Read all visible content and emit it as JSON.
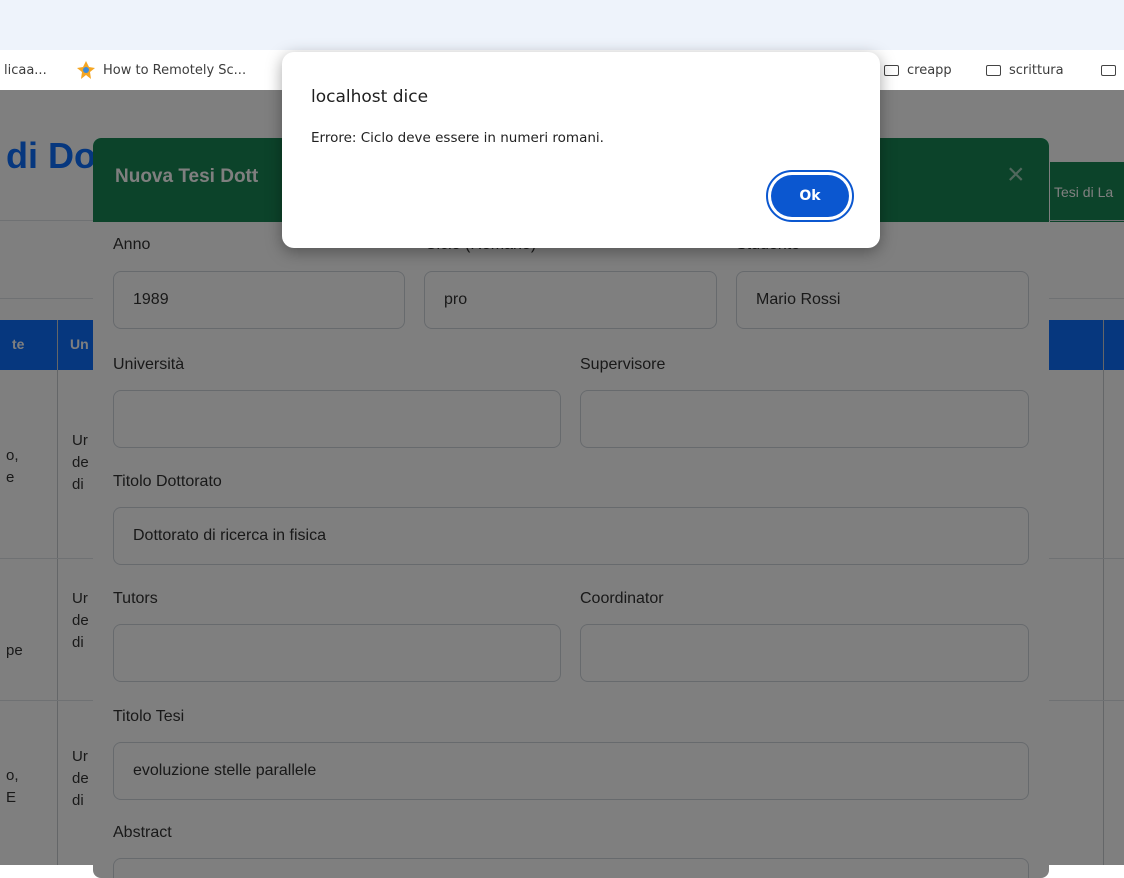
{
  "bookmarks": {
    "left_truncated": "licaa...",
    "how_to": "How to Remotely Sc...",
    "folder1": "creapp",
    "folder2": "scrittura"
  },
  "page": {
    "title_fragment": "di Do",
    "tab_fragment": "Tesi di La",
    "header_cols": [
      "te",
      "Un"
    ],
    "rows": [
      {
        "c1": [
          "o,",
          "e"
        ],
        "c2": [
          "Ur",
          "de",
          "di"
        ]
      },
      {
        "c1": [
          "pe"
        ],
        "c2": [
          "Ur",
          "de",
          "di"
        ]
      },
      {
        "c1": [
          "o,",
          "E"
        ],
        "c2": [
          "Ur",
          "de",
          "di"
        ]
      }
    ]
  },
  "modal": {
    "title": "Nuova Tesi Dott",
    "close": "×",
    "labels": {
      "anno": "Anno",
      "ciclo": "Ciclo (Romano)",
      "studente": "Studente",
      "universita": "Università",
      "supervisore": "Supervisore",
      "titolo_dottorato": "Titolo Dottorato",
      "tutors": "Tutors",
      "coordinator": "Coordinator",
      "titolo_tesi": "Titolo Tesi",
      "abstract": "Abstract"
    },
    "values": {
      "anno": "1989",
      "ciclo": "pro",
      "studente": "Mario Rossi",
      "universita": "",
      "supervisore": "",
      "titolo_dottorato": "Dottorato di ricerca in fisica",
      "tutors": "",
      "coordinator": "",
      "titolo_tesi": "evoluzione stelle parallele"
    }
  },
  "alert": {
    "title": "localhost dice",
    "message": "Errore: Ciclo deve essere in numeri romani.",
    "ok_label": "Ok"
  },
  "colors": {
    "primary": "#0d6efd",
    "success": "#198754",
    "alert_button": "#0b57d0"
  },
  "icons": [
    "folder-icon",
    "bookmark-favicon",
    "close-icon"
  ]
}
